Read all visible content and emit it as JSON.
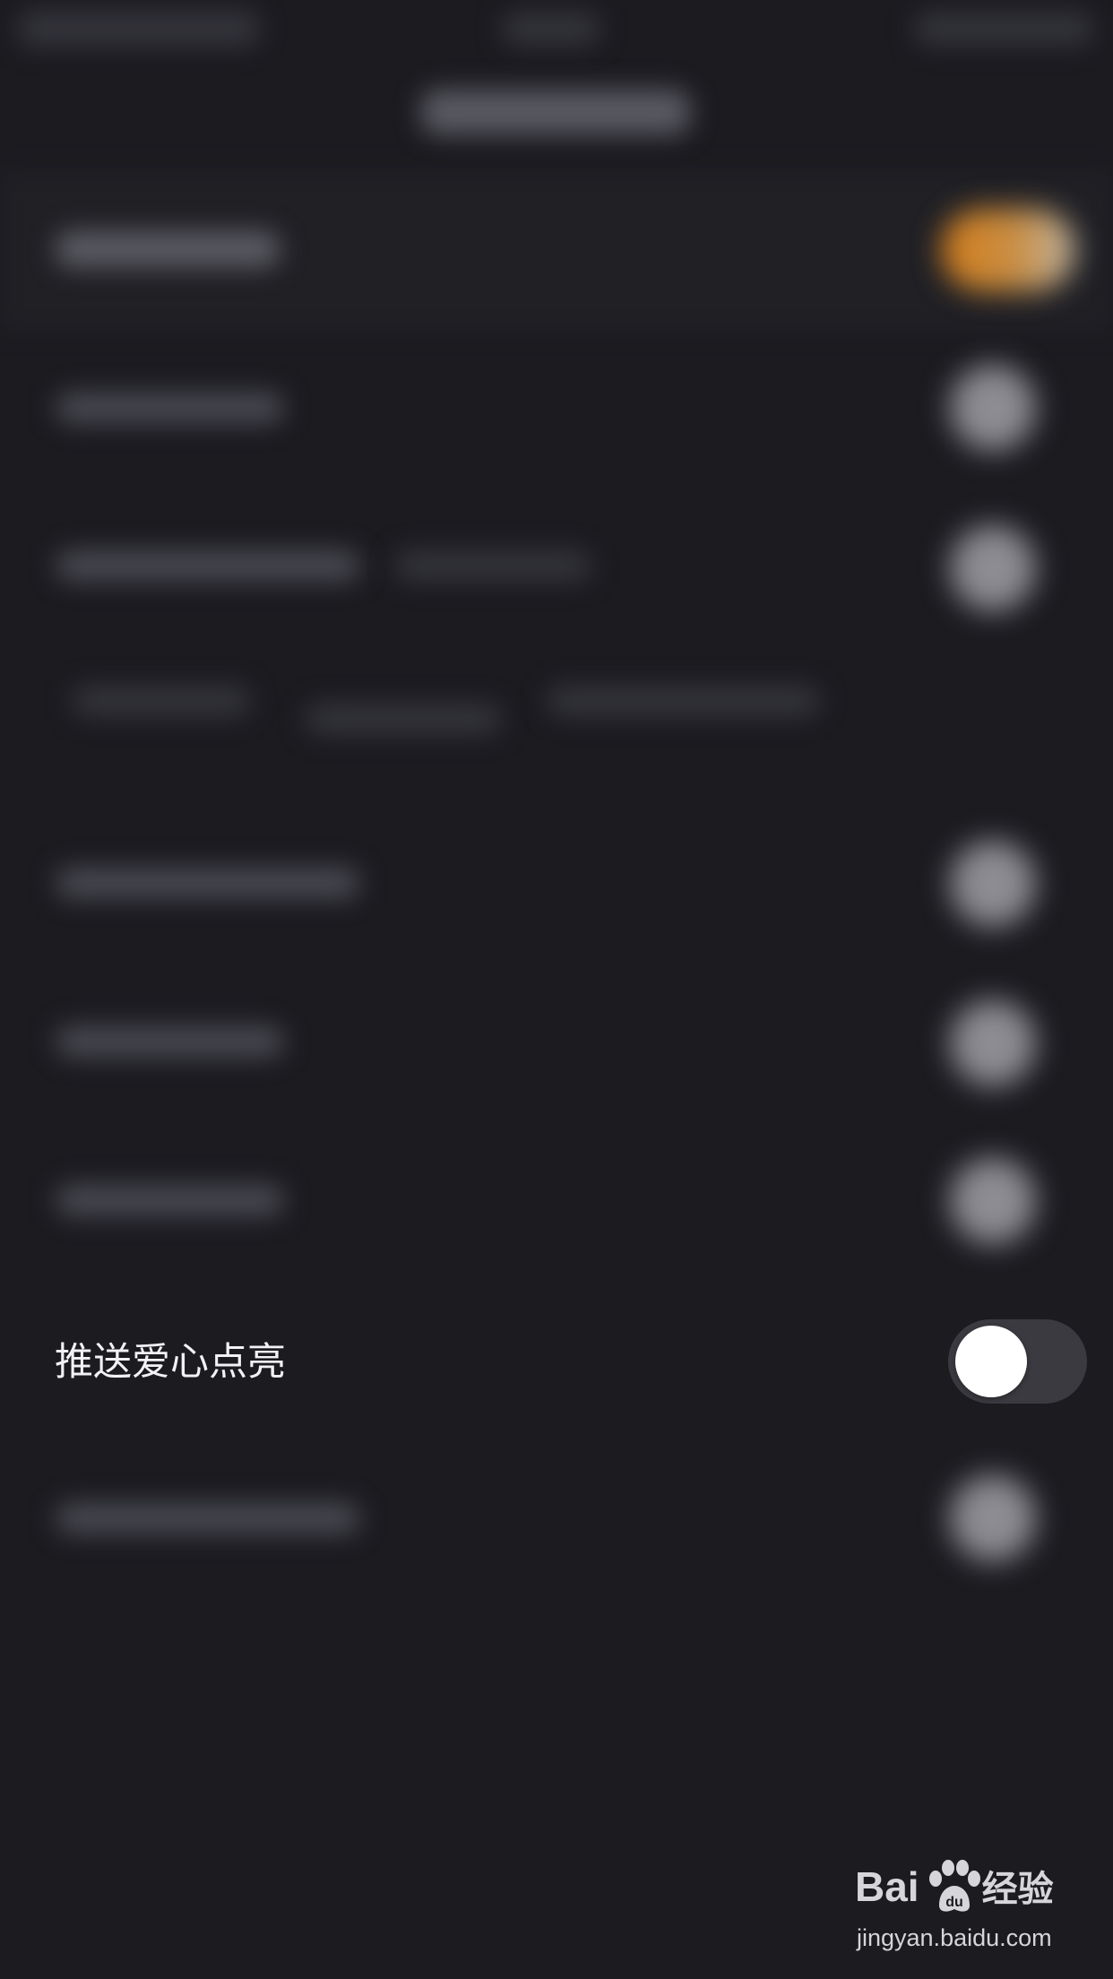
{
  "setting": {
    "label": "推送爱心点亮",
    "toggle_on": false
  },
  "watermark": {
    "brand_left": "Bai",
    "brand_right": "经验",
    "url": "jingyan.baidu.com"
  },
  "colors": {
    "background": "#1b1b20",
    "accent": "#d27c1a",
    "toggle_track": "#3a3a40",
    "toggle_knob": "#ffffff",
    "text": "#f2f2f4"
  }
}
